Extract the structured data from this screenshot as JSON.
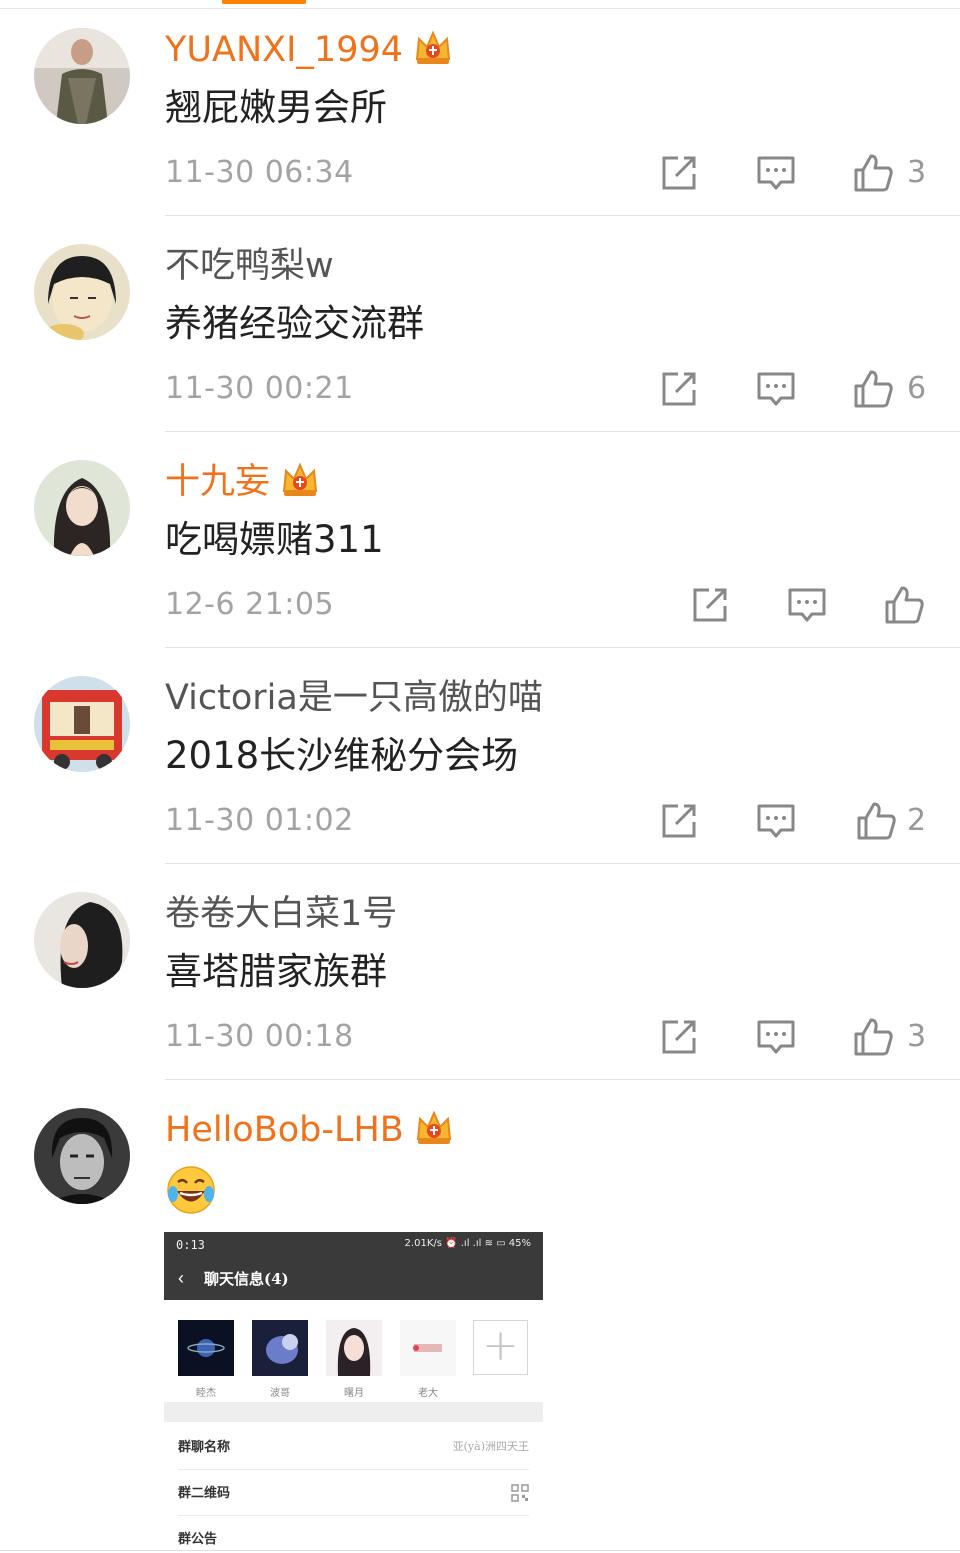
{
  "comments": [
    {
      "name": "YUANXI_1994",
      "vip": true,
      "text": "翘屁嫩男会所",
      "time": "11-30 06:34",
      "likes": "3"
    },
    {
      "name": "不吃鸭梨w",
      "vip": false,
      "text": "养猪经验交流群",
      "time": "11-30 00:21",
      "likes": "6"
    },
    {
      "name": "十九妄",
      "vip": true,
      "text": "吃喝嫖赌311",
      "time": "12-6 21:05",
      "likes": ""
    },
    {
      "name": "Victoria是一只高傲的喵",
      "vip": false,
      "text": "2018长沙维秘分会场",
      "time": "11-30 01:02",
      "likes": "2"
    },
    {
      "name": "卷卷大白菜1号",
      "vip": false,
      "text": "喜塔腊家族群",
      "time": "11-30 00:18",
      "likes": "3"
    },
    {
      "name": "HelloBob-LHB",
      "vip": true,
      "text": "😂",
      "time": "",
      "likes": ""
    }
  ],
  "embedded": {
    "status_time": "0:13",
    "status_right": "2.01K/s ⏰ .ıl .ıl ≋ ▭ 45%",
    "title": "聊天信息(4)",
    "members": [
      "睦杰",
      "波哥",
      "曙月",
      "老大"
    ],
    "rows": [
      {
        "label": "群聊名称",
        "value": "亚(yà)洲四天王"
      },
      {
        "label": "群二维码",
        "value": ""
      },
      {
        "label": "群公告",
        "value": ""
      }
    ]
  },
  "colors": {
    "vip_name": "#f0731c",
    "plain_name": "#555555",
    "time": "#a3a3a3",
    "accent": "#ff8200"
  }
}
